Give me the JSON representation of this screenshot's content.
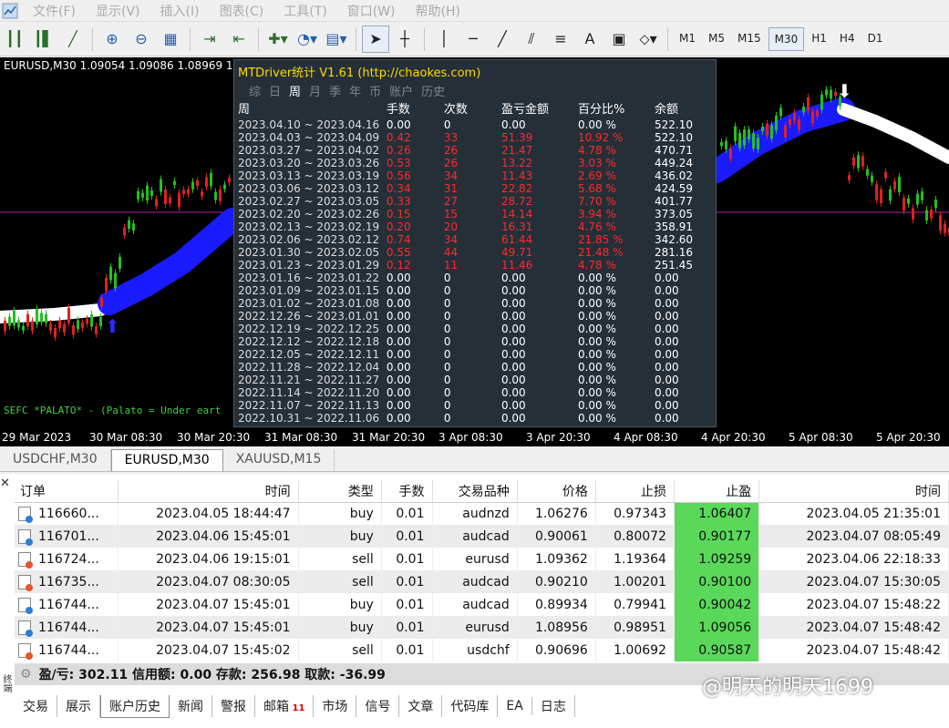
{
  "menu": [
    "文件(F)",
    "显示(V)",
    "插入(I)",
    "图表(C)",
    "工具(T)",
    "窗口(W)",
    "帮助(H)"
  ],
  "timeframes": [
    "M1",
    "M5",
    "M15",
    "M30",
    "H1",
    "H4",
    "D1"
  ],
  "active_timeframe": "M30",
  "chart": {
    "title": "EURUSD,M30  1.09054 1.09086 1.08969 1.0",
    "note": "SEFC *PALATO* - (Palato = Under eart",
    "x_labels": [
      "29 Mar 2023",
      "30 Mar 08:30",
      "30 Mar 20:30",
      "31 Mar 08:30",
      "31 Mar 20:30",
      "3 Apr 08:30",
      "3 Apr 20:30",
      "4 Apr 08:30",
      "4 Apr 20:30",
      "5 Apr 08:30",
      "5 Apr 20:30"
    ]
  },
  "panel": {
    "title": "MTDriver统计 V1.61  (http://chaokes.com)",
    "tabs": [
      "综",
      "日",
      "周",
      "月",
      "季",
      "年",
      "币",
      "账户",
      "历史"
    ],
    "active_tab": "周",
    "headers": [
      "周",
      "手数",
      "次数",
      "盈亏金额",
      "百分比%",
      "余额"
    ],
    "rows": [
      [
        "2023.04.10 ~ 2023.04.16",
        "0.00",
        "0",
        "0.00",
        "0.00 %",
        "522.10"
      ],
      [
        "2023.04.03 ~ 2023.04.09",
        "0.42",
        "33",
        "51.39",
        "10.92 %",
        "522.10"
      ],
      [
        "2023.03.27 ~ 2023.04.02",
        "0.26",
        "26",
        "21.47",
        "4.78 %",
        "470.71"
      ],
      [
        "2023.03.20 ~ 2023.03.26",
        "0.53",
        "26",
        "13.22",
        "3.03 %",
        "449.24"
      ],
      [
        "2023.03.13 ~ 2023.03.19",
        "0.56",
        "34",
        "11.43",
        "2.69 %",
        "436.02"
      ],
      [
        "2023.03.06 ~ 2023.03.12",
        "0.34",
        "31",
        "22.82",
        "5.68 %",
        "424.59"
      ],
      [
        "2023.02.27 ~ 2023.03.05",
        "0.33",
        "27",
        "28.72",
        "7.70 %",
        "401.77"
      ],
      [
        "2023.02.20 ~ 2023.02.26",
        "0.15",
        "15",
        "14.14",
        "3.94 %",
        "373.05"
      ],
      [
        "2023.02.13 ~ 2023.02.19",
        "0.20",
        "20",
        "16.31",
        "4.76 %",
        "358.91"
      ],
      [
        "2023.02.06 ~ 2023.02.12",
        "0.74",
        "34",
        "61.44",
        "21.85 %",
        "342.60"
      ],
      [
        "2023.01.30 ~ 2023.02.05",
        "0.55",
        "44",
        "49.71",
        "21.48 %",
        "281.16"
      ],
      [
        "2023.01.23 ~ 2023.01.29",
        "0.12",
        "11",
        "11.46",
        "4.78 %",
        "251.45"
      ],
      [
        "2023.01.16 ~ 2023.01.22",
        "0.00",
        "0",
        "0.00",
        "0.00 %",
        "0.00"
      ],
      [
        "2023.01.09 ~ 2023.01.15",
        "0.00",
        "0",
        "0.00",
        "0.00 %",
        "0.00"
      ],
      [
        "2023.01.02 ~ 2023.01.08",
        "0.00",
        "0",
        "0.00",
        "0.00 %",
        "0.00"
      ],
      [
        "2022.12.26 ~ 2023.01.01",
        "0.00",
        "0",
        "0.00",
        "0.00 %",
        "0.00"
      ],
      [
        "2022.12.19 ~ 2022.12.25",
        "0.00",
        "0",
        "0.00",
        "0.00 %",
        "0.00"
      ],
      [
        "2022.12.12 ~ 2022.12.18",
        "0.00",
        "0",
        "0.00",
        "0.00 %",
        "0.00"
      ],
      [
        "2022.12.05 ~ 2022.12.11",
        "0.00",
        "0",
        "0.00",
        "0.00 %",
        "0.00"
      ],
      [
        "2022.11.28 ~ 2022.12.04",
        "0.00",
        "0",
        "0.00",
        "0.00 %",
        "0.00"
      ],
      [
        "2022.11.21 ~ 2022.11.27",
        "0.00",
        "0",
        "0.00",
        "0.00 %",
        "0.00"
      ],
      [
        "2022.11.14 ~ 2022.11.20",
        "0.00",
        "0",
        "0.00",
        "0.00 %",
        "0.00"
      ],
      [
        "2022.11.07 ~ 2022.11.13",
        "0.00",
        "0",
        "0.00",
        "0.00 %",
        "0.00"
      ],
      [
        "2022.10.31 ~ 2022.11.06",
        "0.00",
        "0",
        "0.00",
        "0.00 %",
        "0.00"
      ]
    ]
  },
  "symbol_tabs": [
    "USDCHF,M30",
    "EURUSD,M30",
    "XAUUSD,M15"
  ],
  "active_symbol_tab": "EURUSD,M30",
  "orders": {
    "headers": [
      "订单",
      "时间",
      "类型",
      "手数",
      "交易品种",
      "价格",
      "止损",
      "止盈",
      "时间"
    ],
    "rows": [
      {
        "id": "116660...",
        "time": "2023.04.05 18:44:47",
        "type": "buy",
        "lots": "0.01",
        "symbol": "audnzd",
        "price": "1.06276",
        "sl": "0.97343",
        "tp": "1.06407",
        "close_time": "2023.04.05 21:35:01"
      },
      {
        "id": "116701...",
        "time": "2023.04.06 15:45:01",
        "type": "buy",
        "lots": "0.01",
        "symbol": "audcad",
        "price": "0.90061",
        "sl": "0.80072",
        "tp": "0.90177",
        "close_time": "2023.04.07 08:05:49"
      },
      {
        "id": "116724...",
        "time": "2023.04.06 19:15:01",
        "type": "sell",
        "lots": "0.01",
        "symbol": "eurusd",
        "price": "1.09362",
        "sl": "1.19364",
        "tp": "1.09259",
        "close_time": "2023.04.06 22:18:33"
      },
      {
        "id": "116735...",
        "time": "2023.04.07 08:30:05",
        "type": "sell",
        "lots": "0.01",
        "symbol": "audcad",
        "price": "0.90210",
        "sl": "1.00201",
        "tp": "0.90100",
        "close_time": "2023.04.07 15:30:05"
      },
      {
        "id": "116744...",
        "time": "2023.04.07 15:45:01",
        "type": "buy",
        "lots": "0.01",
        "symbol": "audcad",
        "price": "0.89934",
        "sl": "0.79941",
        "tp": "0.90042",
        "close_time": "2023.04.07 15:48:22"
      },
      {
        "id": "116744...",
        "time": "2023.04.07 15:45:01",
        "type": "buy",
        "lots": "0.01",
        "symbol": "eurusd",
        "price": "1.08956",
        "sl": "0.98951",
        "tp": "1.09056",
        "close_time": "2023.04.07 15:48:42"
      },
      {
        "id": "116744...",
        "time": "2023.04.07 15:45:02",
        "type": "sell",
        "lots": "0.01",
        "symbol": "usdchf",
        "price": "0.90696",
        "sl": "1.00692",
        "tp": "0.90587",
        "close_time": "2023.04.07 15:48:42"
      }
    ]
  },
  "summary": "盈/亏: 302.11  信用额: 0.00  存款: 256.98  取款: -36.99",
  "bottom_tabs": [
    "交易",
    "展示",
    "账户历史",
    "新闻",
    "警报",
    "邮箱",
    "市场",
    "信号",
    "文章",
    "代码库",
    "EA",
    "日志"
  ],
  "active_bottom_tab": "账户历史",
  "mail_badge": "11",
  "watermark": "@明天的明天1699",
  "colors": {
    "buy_icon": "#2a7fd4",
    "sell_icon": "#e2572b",
    "tp_highlight": "#5ad85a",
    "ma_band": "#1a1aff",
    "loss_text": "#ff2a2a"
  }
}
